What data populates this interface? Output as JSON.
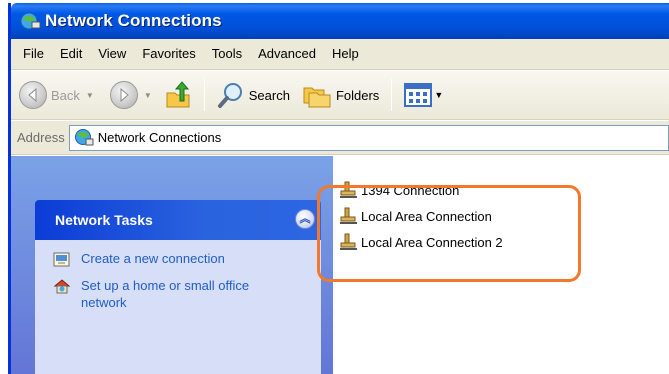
{
  "window": {
    "title": "Network Connections"
  },
  "menu": {
    "items": [
      "File",
      "Edit",
      "View",
      "Favorites",
      "Tools",
      "Advanced",
      "Help"
    ]
  },
  "toolbar": {
    "back_label": "Back",
    "search_label": "Search",
    "folders_label": "Folders"
  },
  "address": {
    "label": "Address",
    "value": "Network Connections"
  },
  "tasks": {
    "header": "Network Tasks",
    "items": [
      {
        "label": "Create a new connection",
        "icon": "new-connection-icon"
      },
      {
        "label": "Set up a home or small office network",
        "icon": "home-network-icon"
      }
    ]
  },
  "connections": {
    "items": [
      {
        "name": "1394 Connection",
        "icon": "network-connection-icon"
      },
      {
        "name": "Local Area Connection",
        "icon": "network-connection-icon"
      },
      {
        "name": "Local Area Connection 2",
        "icon": "network-connection-icon"
      }
    ]
  },
  "colors": {
    "title_bar": "#0058e6",
    "task_pane": "#7ba2e7",
    "task_link": "#215dc6",
    "highlight": "#f2782a"
  }
}
